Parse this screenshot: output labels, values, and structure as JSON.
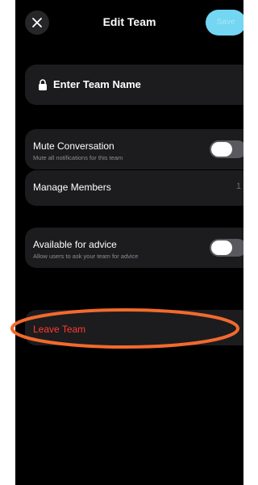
{
  "header": {
    "title": "Edit Team",
    "save_label": "Save",
    "close_icon": "close-icon"
  },
  "team_name": {
    "label": "Enter Team Name",
    "icon": "lock-icon"
  },
  "mute": {
    "title": "Mute Conversation",
    "subtitle": "Mute all notifications for this team",
    "enabled": false
  },
  "members": {
    "label": "Manage Members",
    "count": "1",
    "chevron": "›"
  },
  "advice": {
    "title": "Available for advice",
    "subtitle": "Allow users to ask your team for advice",
    "enabled": false
  },
  "leave": {
    "label": "Leave Team"
  },
  "colors": {
    "accent": "#73d6f2",
    "danger": "#ff3b30",
    "annotation": "#f26a2e",
    "card": "#1c1c1e"
  }
}
